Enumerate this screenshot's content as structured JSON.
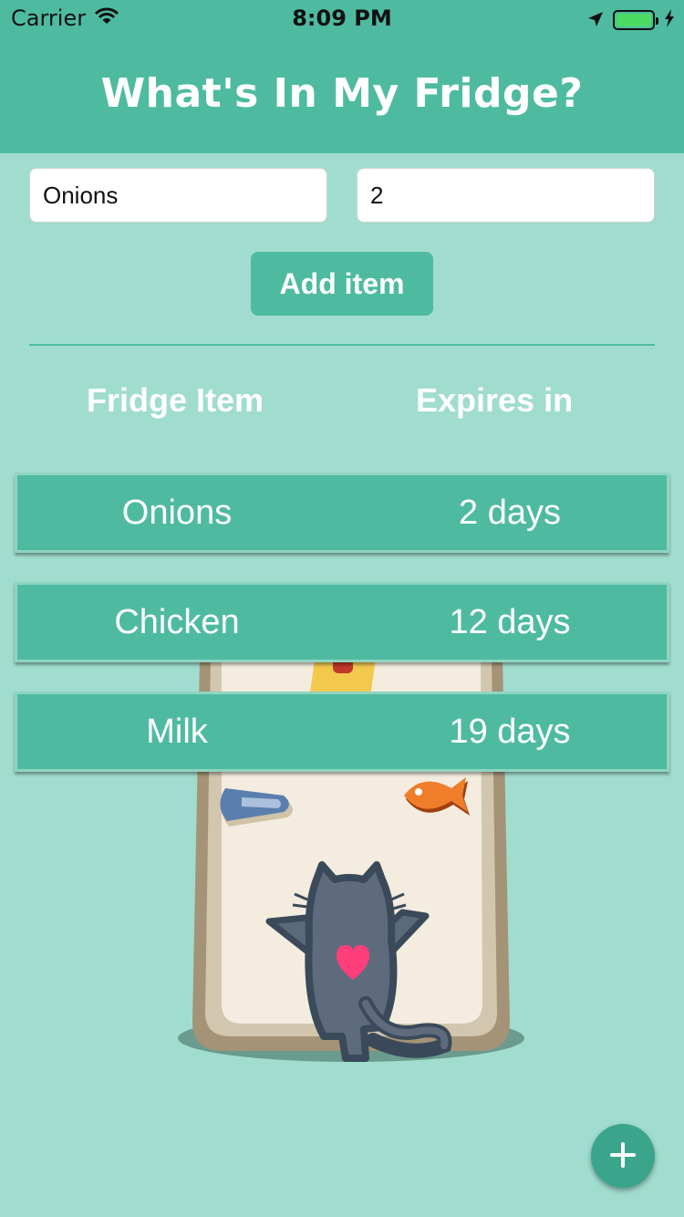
{
  "status_bar": {
    "carrier": "Carrier",
    "time": "8:09 PM"
  },
  "header": {
    "title": "What's In My Fridge?"
  },
  "form": {
    "item_value": "Onions",
    "quantity_value": "2",
    "add_button_label": "Add item"
  },
  "table": {
    "columns": [
      "Fridge Item",
      "Expires in"
    ],
    "rows": [
      {
        "item": "Onions",
        "expires": "2 days"
      },
      {
        "item": "Chicken",
        "expires": "12 days"
      },
      {
        "item": "Milk",
        "expires": "19 days"
      }
    ]
  },
  "fab": {
    "icon": "plus-icon"
  },
  "colors": {
    "primary": "#4ebba0",
    "background": "#a1ddce",
    "battery": "#4cd964",
    "heart": "#ff3e7c"
  }
}
